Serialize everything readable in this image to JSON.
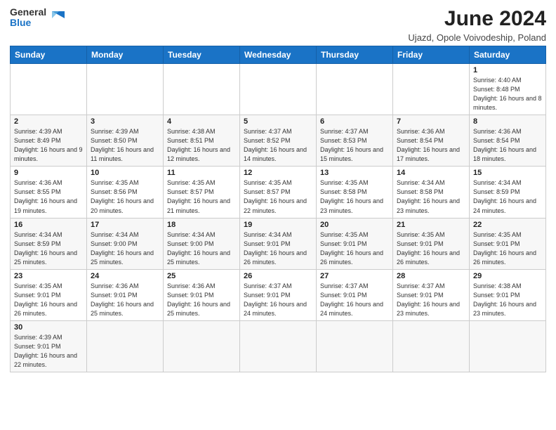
{
  "logo": {
    "text_general": "General",
    "text_blue": "Blue"
  },
  "title": "June 2024",
  "subtitle": "Ujazd, Opole Voivodeship, Poland",
  "weekdays": [
    "Sunday",
    "Monday",
    "Tuesday",
    "Wednesday",
    "Thursday",
    "Friday",
    "Saturday"
  ],
  "weeks": [
    [
      {
        "day": "",
        "info": ""
      },
      {
        "day": "",
        "info": ""
      },
      {
        "day": "",
        "info": ""
      },
      {
        "day": "",
        "info": ""
      },
      {
        "day": "",
        "info": ""
      },
      {
        "day": "",
        "info": ""
      },
      {
        "day": "1",
        "info": "Sunrise: 4:40 AM\nSunset: 8:48 PM\nDaylight: 16 hours and 8 minutes."
      }
    ],
    [
      {
        "day": "2",
        "info": "Sunrise: 4:39 AM\nSunset: 8:49 PM\nDaylight: 16 hours and 9 minutes."
      },
      {
        "day": "3",
        "info": "Sunrise: 4:39 AM\nSunset: 8:50 PM\nDaylight: 16 hours and 11 minutes."
      },
      {
        "day": "4",
        "info": "Sunrise: 4:38 AM\nSunset: 8:51 PM\nDaylight: 16 hours and 12 minutes."
      },
      {
        "day": "5",
        "info": "Sunrise: 4:37 AM\nSunset: 8:52 PM\nDaylight: 16 hours and 14 minutes."
      },
      {
        "day": "6",
        "info": "Sunrise: 4:37 AM\nSunset: 8:53 PM\nDaylight: 16 hours and 15 minutes."
      },
      {
        "day": "7",
        "info": "Sunrise: 4:36 AM\nSunset: 8:54 PM\nDaylight: 16 hours and 17 minutes."
      },
      {
        "day": "8",
        "info": "Sunrise: 4:36 AM\nSunset: 8:54 PM\nDaylight: 16 hours and 18 minutes."
      }
    ],
    [
      {
        "day": "9",
        "info": "Sunrise: 4:36 AM\nSunset: 8:55 PM\nDaylight: 16 hours and 19 minutes."
      },
      {
        "day": "10",
        "info": "Sunrise: 4:35 AM\nSunset: 8:56 PM\nDaylight: 16 hours and 20 minutes."
      },
      {
        "day": "11",
        "info": "Sunrise: 4:35 AM\nSunset: 8:57 PM\nDaylight: 16 hours and 21 minutes."
      },
      {
        "day": "12",
        "info": "Sunrise: 4:35 AM\nSunset: 8:57 PM\nDaylight: 16 hours and 22 minutes."
      },
      {
        "day": "13",
        "info": "Sunrise: 4:35 AM\nSunset: 8:58 PM\nDaylight: 16 hours and 23 minutes."
      },
      {
        "day": "14",
        "info": "Sunrise: 4:34 AM\nSunset: 8:58 PM\nDaylight: 16 hours and 23 minutes."
      },
      {
        "day": "15",
        "info": "Sunrise: 4:34 AM\nSunset: 8:59 PM\nDaylight: 16 hours and 24 minutes."
      }
    ],
    [
      {
        "day": "16",
        "info": "Sunrise: 4:34 AM\nSunset: 8:59 PM\nDaylight: 16 hours and 25 minutes."
      },
      {
        "day": "17",
        "info": "Sunrise: 4:34 AM\nSunset: 9:00 PM\nDaylight: 16 hours and 25 minutes."
      },
      {
        "day": "18",
        "info": "Sunrise: 4:34 AM\nSunset: 9:00 PM\nDaylight: 16 hours and 25 minutes."
      },
      {
        "day": "19",
        "info": "Sunrise: 4:34 AM\nSunset: 9:01 PM\nDaylight: 16 hours and 26 minutes."
      },
      {
        "day": "20",
        "info": "Sunrise: 4:35 AM\nSunset: 9:01 PM\nDaylight: 16 hours and 26 minutes."
      },
      {
        "day": "21",
        "info": "Sunrise: 4:35 AM\nSunset: 9:01 PM\nDaylight: 16 hours and 26 minutes."
      },
      {
        "day": "22",
        "info": "Sunrise: 4:35 AM\nSunset: 9:01 PM\nDaylight: 16 hours and 26 minutes."
      }
    ],
    [
      {
        "day": "23",
        "info": "Sunrise: 4:35 AM\nSunset: 9:01 PM\nDaylight: 16 hours and 26 minutes."
      },
      {
        "day": "24",
        "info": "Sunrise: 4:36 AM\nSunset: 9:01 PM\nDaylight: 16 hours and 25 minutes."
      },
      {
        "day": "25",
        "info": "Sunrise: 4:36 AM\nSunset: 9:01 PM\nDaylight: 16 hours and 25 minutes."
      },
      {
        "day": "26",
        "info": "Sunrise: 4:37 AM\nSunset: 9:01 PM\nDaylight: 16 hours and 24 minutes."
      },
      {
        "day": "27",
        "info": "Sunrise: 4:37 AM\nSunset: 9:01 PM\nDaylight: 16 hours and 24 minutes."
      },
      {
        "day": "28",
        "info": "Sunrise: 4:37 AM\nSunset: 9:01 PM\nDaylight: 16 hours and 23 minutes."
      },
      {
        "day": "29",
        "info": "Sunrise: 4:38 AM\nSunset: 9:01 PM\nDaylight: 16 hours and 23 minutes."
      }
    ],
    [
      {
        "day": "30",
        "info": "Sunrise: 4:39 AM\nSunset: 9:01 PM\nDaylight: 16 hours and 22 minutes."
      },
      {
        "day": "",
        "info": ""
      },
      {
        "day": "",
        "info": ""
      },
      {
        "day": "",
        "info": ""
      },
      {
        "day": "",
        "info": ""
      },
      {
        "day": "",
        "info": ""
      },
      {
        "day": "",
        "info": ""
      }
    ]
  ]
}
